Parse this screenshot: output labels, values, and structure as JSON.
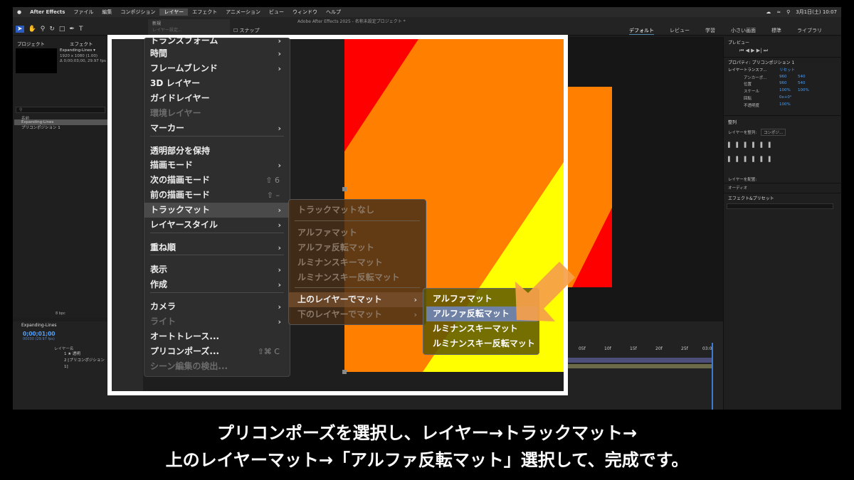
{
  "menubar": {
    "app": "After Effects",
    "items": [
      "ファイル",
      "編集",
      "コンポジション",
      "レイヤー",
      "エフェクト",
      "アニメーション",
      "ビュー",
      "ウィンドウ",
      "ヘルプ"
    ],
    "date": "3月1日(土) 10:07"
  },
  "window_title": "Adobe After Effects 2025 - 名称未設定プロジェクト *",
  "toolbar": {
    "snap": "スナップ",
    "workspaces": [
      "デフォルト",
      "レビュー",
      "学習",
      "小さい画面",
      "標準",
      "ライブラリ"
    ],
    "dropdown": [
      "新規",
      "レイヤー設定..."
    ]
  },
  "project": {
    "tab": "プロジェクト",
    "tab2": "エフェクト",
    "item_name": "Expanding-Lines ▾",
    "item_dims": "1920 x 1080 (1.00)",
    "item_dur": "Δ 0;00;03;00, 29.97 fps",
    "col_name": "名前",
    "items": [
      "Expanding-Lines",
      "プリコンポジション 1"
    ],
    "bpc": "8 bpc"
  },
  "timeline": {
    "tab": "Expanding-Lines",
    "time": "0;00;01;00",
    "fps": "00030 (29.97 fps)",
    "col_layer": "レイヤー名",
    "layers": [
      {
        "num": "1",
        "name": "★ 透明"
      },
      {
        "num": "2",
        "name": "[プリコンポジション 1]"
      }
    ],
    "ruler": [
      "05f",
      "10f",
      "15f",
      "20f",
      "25f",
      "03:0"
    ]
  },
  "right_panel": {
    "preview": "プレビュー",
    "properties": "プロパティ: プリコンポジション 1",
    "layer_transform": "レイヤートランスフ...",
    "reset": "リセット",
    "anchor": "アンカーポ...",
    "anchor_vals": [
      "960",
      "540"
    ],
    "position": "位置",
    "position_vals": [
      "960",
      "540"
    ],
    "scale": "スケール",
    "scale_vals": [
      "100%",
      "100%"
    ],
    "rotation": "回転",
    "rotation_val": "0x+0°",
    "opacity": "不透明度",
    "opacity_val": "100%",
    "align": "整列",
    "align_to": "レイヤーを整列:",
    "align_target": "コンポジ...",
    "distribute": "レイヤーを配置:",
    "audio": "オーディオ",
    "effects": "エフェクト&プリセット"
  },
  "layer_menu": {
    "items": [
      {
        "label": "トランスフォーム",
        "arrow": true,
        "disabled": false
      },
      {
        "label": "時間",
        "arrow": true,
        "disabled": false
      },
      {
        "label": "フレームブレンド",
        "arrow": true,
        "disabled": false
      },
      {
        "label": "3D レイヤー",
        "arrow": false,
        "disabled": false
      },
      {
        "label": "ガイドレイヤー",
        "arrow": false,
        "disabled": false
      },
      {
        "label": "環境レイヤー",
        "arrow": false,
        "disabled": true
      },
      {
        "label": "マーカー",
        "arrow": true,
        "disabled": false
      },
      {
        "label": "透明部分を保持",
        "arrow": false,
        "disabled": false
      },
      {
        "label": "描画モード",
        "arrow": true,
        "disabled": false
      },
      {
        "label": "次の描画モード",
        "shortcut": "⇧ 6",
        "disabled": false
      },
      {
        "label": "前の描画モード",
        "shortcut": "⇧ –",
        "disabled": false
      },
      {
        "label": "トラックマット",
        "arrow": true,
        "disabled": false,
        "highlight": true
      },
      {
        "label": "レイヤースタイル",
        "arrow": true,
        "disabled": false
      },
      {
        "label": "重ね順",
        "arrow": true,
        "disabled": false
      },
      {
        "label": "表示",
        "arrow": true,
        "disabled": false
      },
      {
        "label": "作成",
        "arrow": true,
        "disabled": false
      },
      {
        "label": "カメラ",
        "arrow": true,
        "disabled": false
      },
      {
        "label": "ライト",
        "arrow": true,
        "disabled": true
      },
      {
        "label": "オートトレース...",
        "disabled": false
      },
      {
        "label": "プリコンポーズ...",
        "shortcut": "⇧⌘ C",
        "disabled": false
      },
      {
        "label": "シーン編集の検出...",
        "disabled": true
      }
    ]
  },
  "trackmatte_menu": {
    "items": [
      {
        "label": "トラックマットなし",
        "disabled": true
      },
      {
        "label": "アルファマット",
        "disabled": true
      },
      {
        "label": "アルファ反転マット",
        "disabled": true
      },
      {
        "label": "ルミナンスキーマット",
        "disabled": true
      },
      {
        "label": "ルミナンスキー反転マット",
        "disabled": true
      },
      {
        "label": "上のレイヤーでマット",
        "disabled": false,
        "highlight": true
      },
      {
        "label": "下のレイヤーでマット",
        "disabled": true
      }
    ]
  },
  "mat_menu": {
    "items": [
      {
        "label": "アルファマット"
      },
      {
        "label": "アルファ反転マット",
        "highlight": true
      },
      {
        "label": "ルミナンスキーマット"
      },
      {
        "label": "ルミナンスキー反転マット"
      }
    ]
  },
  "caption": {
    "line1": "プリコンポーズを選択し、レイヤー→トラックマット→",
    "line2": "上のレイヤーマット→「アルファ反転マット」選択して、完成です。"
  },
  "colors": {
    "orange": "#ff8000",
    "red": "#ff0000",
    "yellow": "#ffff00",
    "highlight_blue": "#6f82a6",
    "arrow": "#f5a04a"
  }
}
